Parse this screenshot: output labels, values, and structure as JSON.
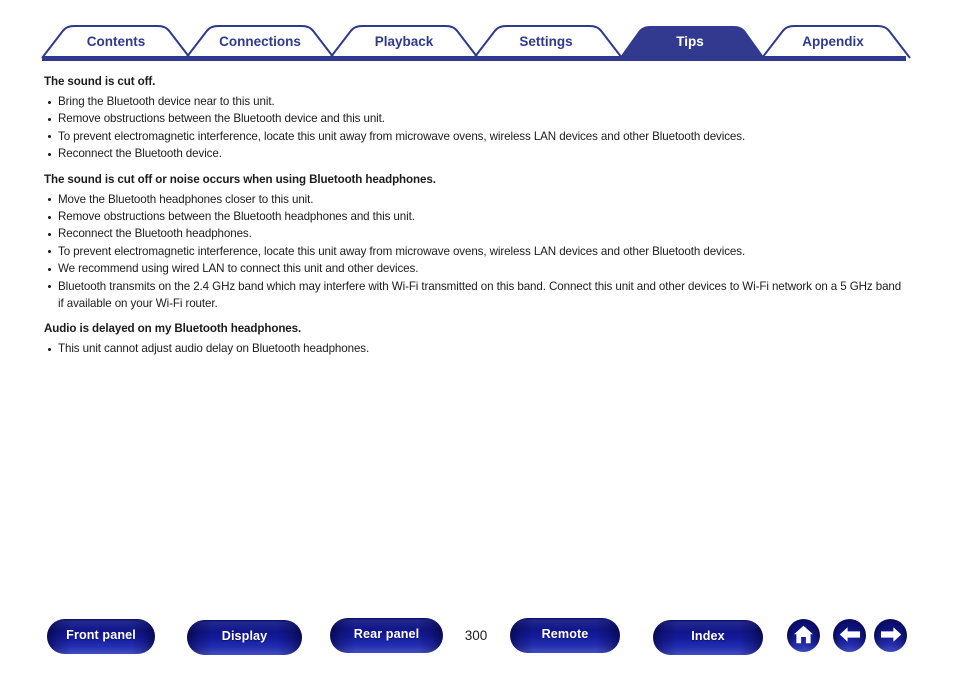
{
  "tabs": [
    {
      "label": "Contents",
      "active": false,
      "name": "tab-contents"
    },
    {
      "label": "Connections",
      "active": false,
      "name": "tab-connections"
    },
    {
      "label": "Playback",
      "active": false,
      "name": "tab-playback"
    },
    {
      "label": "Settings",
      "active": false,
      "name": "tab-settings"
    },
    {
      "label": "Tips",
      "active": true,
      "name": "tab-tips"
    },
    {
      "label": "Appendix",
      "active": false,
      "name": "tab-appendix"
    }
  ],
  "colors": {
    "brand_blue": "#2f3a8f",
    "active_tab_fill": "#313a8f",
    "rule": "#2f3a8f",
    "text": "#1c1c1c",
    "button_text": "#ffffff"
  },
  "content": {
    "sections": [
      {
        "heading": "The sound is cut off.",
        "bullets": [
          "Bring the Bluetooth device near to this unit.",
          "Remove obstructions between the Bluetooth device and this unit.",
          "To prevent electromagnetic interference, locate this unit away from microwave ovens, wireless LAN devices and other Bluetooth devices.",
          "Reconnect the Bluetooth device."
        ]
      },
      {
        "heading": "The sound is cut off or noise occurs when using Bluetooth headphones.",
        "bullets": [
          "Move the Bluetooth headphones closer to this unit.",
          "Remove obstructions between the Bluetooth headphones and this unit.",
          "Reconnect the Bluetooth headphones.",
          "To prevent electromagnetic interference, locate this unit away from microwave ovens, wireless LAN devices and other Bluetooth devices.",
          "We recommend using wired LAN to connect this unit and other devices.",
          "Bluetooth transmits on the 2.4 GHz band which may interfere with Wi-Fi transmitted on this band. Connect this unit and other devices to Wi-Fi network on a 5 GHz band if available on your Wi-Fi router."
        ]
      },
      {
        "heading": "Audio is delayed on my Bluetooth headphones.",
        "bullets": [
          "This unit cannot adjust audio delay on Bluetooth headphones."
        ]
      }
    ]
  },
  "footer": {
    "buttons": [
      {
        "label": "Front panel",
        "name": "front-panel-button"
      },
      {
        "label": "Display",
        "name": "display-button"
      },
      {
        "label": "Rear panel",
        "name": "rear-panel-button"
      },
      {
        "label": "Remote",
        "name": "remote-button"
      },
      {
        "label": "Index",
        "name": "index-button"
      }
    ],
    "page_number": "300",
    "icon_buttons": [
      {
        "name": "home-icon",
        "glyph": "home"
      },
      {
        "name": "arrow-left-icon",
        "glyph": "arrow-left"
      },
      {
        "name": "arrow-right-icon",
        "glyph": "arrow-right"
      }
    ]
  }
}
